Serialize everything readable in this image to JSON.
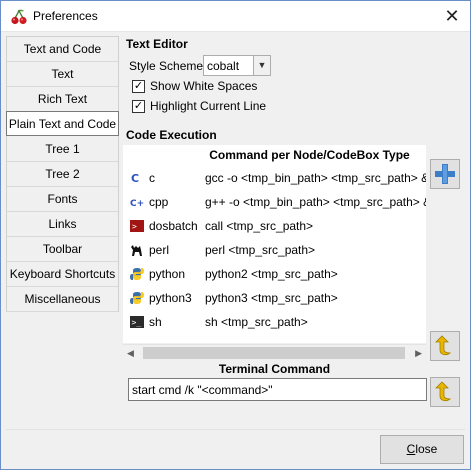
{
  "window": {
    "title": "Preferences",
    "close_glyph": "✕"
  },
  "sidebar": {
    "items": [
      {
        "label": "Text and Code"
      },
      {
        "label": "Text"
      },
      {
        "label": "Rich Text"
      },
      {
        "label": "Plain Text and Code",
        "selected": true
      },
      {
        "label": "Tree 1"
      },
      {
        "label": "Tree 2"
      },
      {
        "label": "Fonts"
      },
      {
        "label": "Links"
      },
      {
        "label": "Toolbar"
      },
      {
        "label": "Keyboard Shortcuts"
      },
      {
        "label": "Miscellaneous"
      }
    ]
  },
  "text_editor": {
    "section_title": "Text Editor",
    "style_scheme_label": "Style Scheme",
    "style_scheme_value": "cobalt",
    "show_white_spaces": {
      "label": "Show White Spaces",
      "checked": true
    },
    "highlight_current_line": {
      "label": "Highlight Current Line",
      "checked": true
    }
  },
  "code_execution": {
    "section_title": "Code Execution",
    "column_header": "Command per Node/CodeBox Type",
    "rows": [
      {
        "lang": "c",
        "cmd": "gcc -o <tmp_bin_path> <tmp_src_path> &&",
        "icon": "c-icon"
      },
      {
        "lang": "cpp",
        "cmd": "g++ -o <tmp_bin_path> <tmp_src_path> &",
        "icon": "cpp-icon"
      },
      {
        "lang": "dosbatch",
        "cmd": "call <tmp_src_path>",
        "icon": "dosbatch-icon"
      },
      {
        "lang": "perl",
        "cmd": "perl <tmp_src_path>",
        "icon": "perl-camel-icon"
      },
      {
        "lang": "python",
        "cmd": "python2 <tmp_src_path>",
        "icon": "python-icon"
      },
      {
        "lang": "python3",
        "cmd": "python3 <tmp_src_path>",
        "icon": "python3-icon"
      },
      {
        "lang": "sh",
        "cmd": "sh <tmp_src_path>",
        "icon": "terminal-icon"
      }
    ]
  },
  "terminal": {
    "title": "Terminal Command",
    "value": "start cmd /k \"<command>\""
  },
  "footer": {
    "close_label_rest": "lose",
    "close_label_underlined": "C"
  },
  "colors": {
    "accent": "#3c7fc8",
    "undo_yellow": "#e8b600"
  }
}
